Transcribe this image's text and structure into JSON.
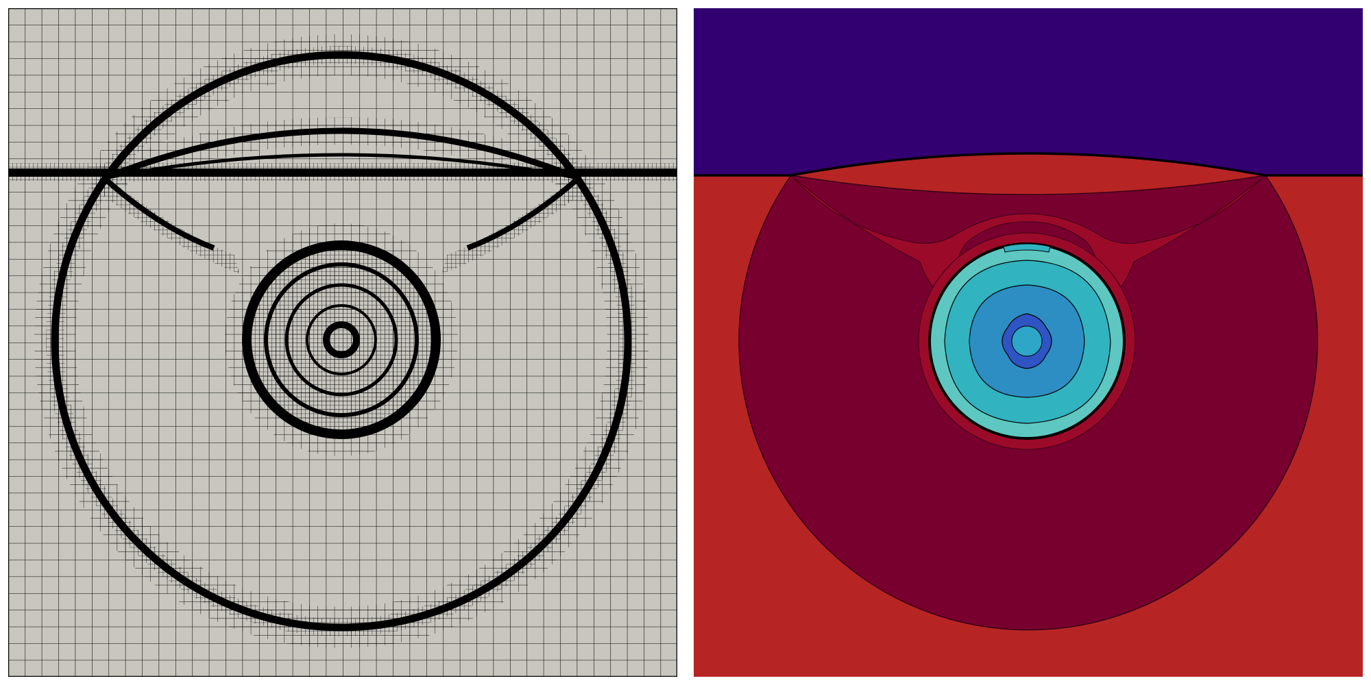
{
  "panels": [
    {
      "id": "mesh",
      "kind": "adaptive-mesh",
      "colors": {
        "background": "#c8c6bf",
        "lines": "#000000"
      }
    },
    {
      "id": "field",
      "kind": "contour-field",
      "colors": {
        "top_region": "#320070",
        "ambient": "#b62524",
        "shock_region": "#77002f",
        "wake_lobes": "#9c0a2a",
        "bubble_outer": "#5ec7c1",
        "bubble_mid": "#31b3c0",
        "bubble_inner": "#2d8ec4",
        "core_ring": "#2f54c3",
        "core": "#2ea6c8"
      }
    }
  ]
}
